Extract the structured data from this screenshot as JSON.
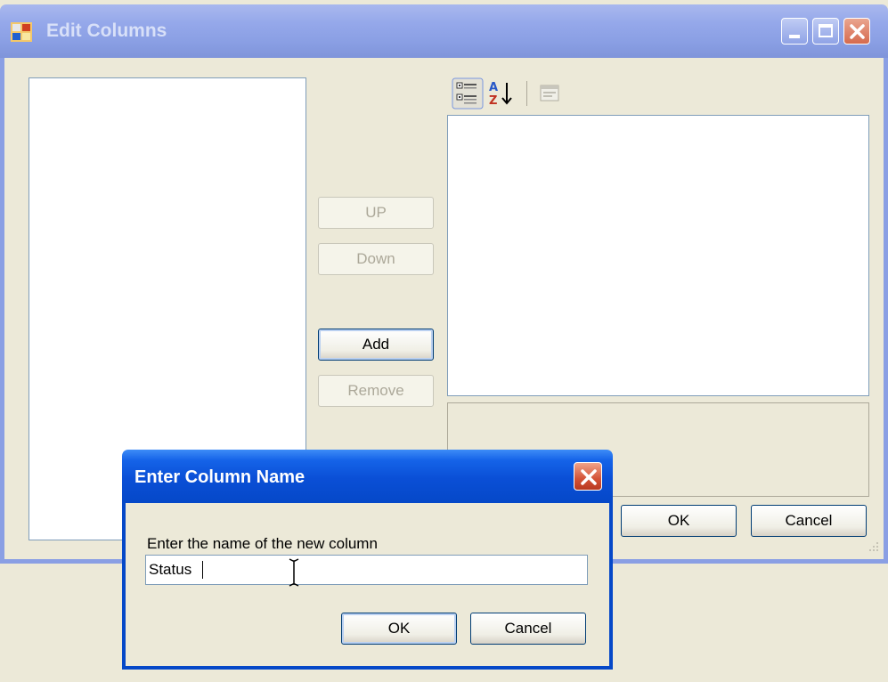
{
  "main_window": {
    "title": "Edit Columns",
    "buttons": {
      "up": "UP",
      "down": "Down",
      "add": "Add",
      "remove": "Remove",
      "ok": "OK",
      "cancel": "Cancel"
    },
    "toolbar": {
      "icons": [
        "categorized-icon",
        "alphabetical-sort-icon",
        "property-pages-icon"
      ]
    },
    "caption_buttons": [
      "minimize",
      "maximize",
      "close"
    ]
  },
  "modal": {
    "title": "Enter Column Name",
    "label": "Enter the name of the new column",
    "input_value": "Status",
    "ok": "OK",
    "cancel": "Cancel"
  },
  "colors": {
    "inactive_titlebar": "#8a9fe4",
    "active_titlebar": "#0a4fd6",
    "dialog_face": "#ece9d8",
    "close_red": "#d45236"
  }
}
